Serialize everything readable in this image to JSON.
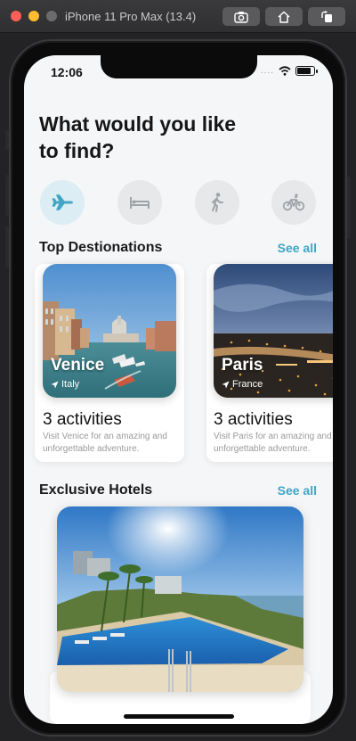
{
  "window": {
    "title": "iPhone 11 Pro Max (13.4)"
  },
  "status_bar": {
    "time": "12:06",
    "signal": "....",
    "icons": [
      "wifi-icon",
      "battery-icon"
    ]
  },
  "header": {
    "title": "What would you like to find?"
  },
  "categories": [
    {
      "name": "plane-icon",
      "active": true
    },
    {
      "name": "bed-icon",
      "active": false
    },
    {
      "name": "walking-icon",
      "active": false
    },
    {
      "name": "bicycle-icon",
      "active": false
    }
  ],
  "destinations": {
    "title": "Top Destionations",
    "see_all": "See all",
    "items": [
      {
        "city": "Venice",
        "country": "Italy",
        "activities": "3 activities",
        "description": "Visit Venice for an amazing and unforgettable adventure."
      },
      {
        "city": "Paris",
        "country": "France",
        "activities": "3 activities",
        "description": "Visit Paris for an amazing and unforgettable adventure."
      }
    ]
  },
  "hotels": {
    "title": "Exclusive Hotels",
    "see_all": "See all"
  },
  "colors": {
    "accent": "#3fa6c6",
    "active_icon": "#3fa6c6",
    "inactive_icon": "#a0a4a8",
    "background": "#f5f6f8"
  }
}
